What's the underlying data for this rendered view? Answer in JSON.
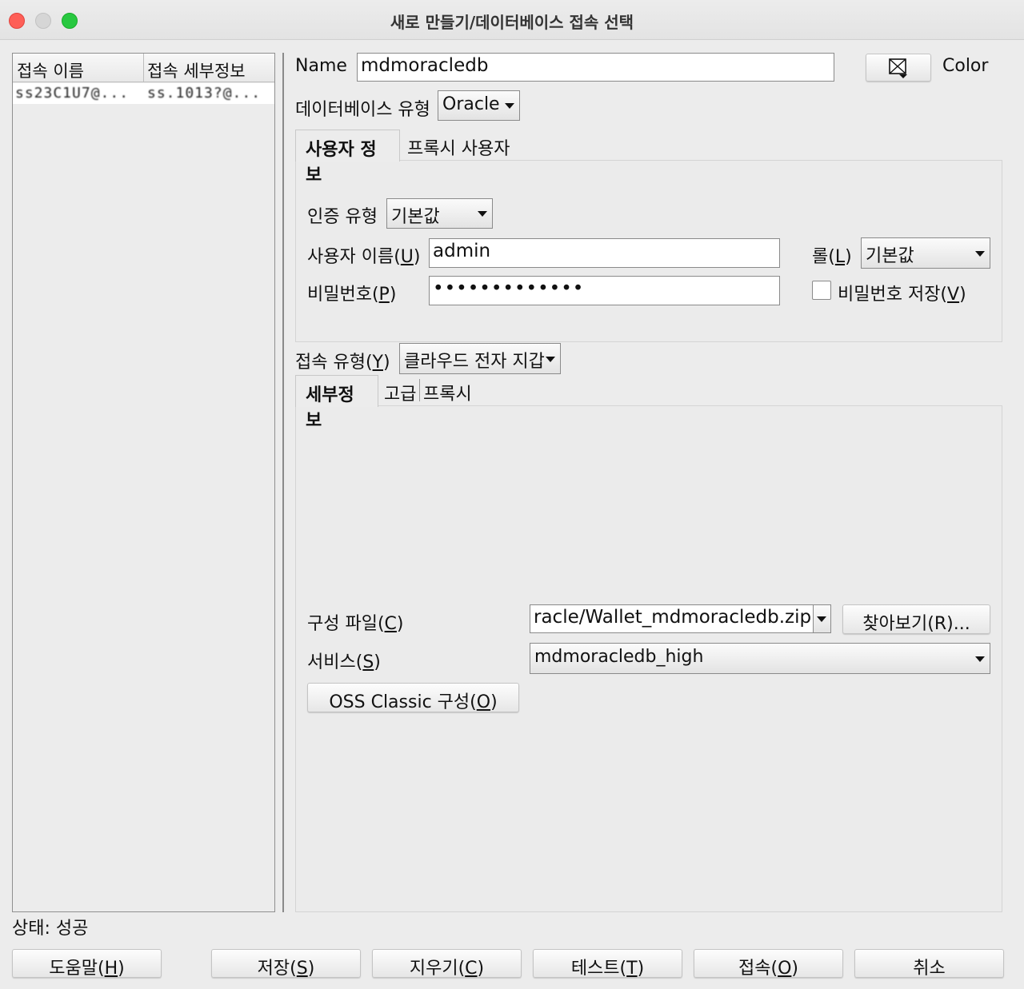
{
  "window": {
    "title": "새로 만들기/데이터베이스 접속 선택"
  },
  "connection_list": {
    "columns": [
      "접속 이름",
      "접속 세부정보"
    ],
    "rows": [
      {
        "name": "ss23C1U7@...",
        "details": "ss.1013?@..."
      }
    ]
  },
  "form": {
    "name_label": "Name",
    "name_value": "mdmoracledb",
    "color_label": "Color",
    "color_icon": "color-picker-icon",
    "db_type_label": "데이터베이스 유형",
    "db_type_value": "Oracle",
    "tabs_user": [
      "사용자 정보",
      "프록시 사용자"
    ],
    "auth_type_label": "인증 유형",
    "auth_type_value": "기본값",
    "username_label_pre": "사용자 이름(",
    "username_mnemonic": "U",
    "username_label_post": ")",
    "username_value": "admin",
    "role_label_pre": "롤(",
    "role_mnemonic": "L",
    "role_label_post": ")",
    "role_value": "기본값",
    "password_label_pre": "비밀번호(",
    "password_mnemonic": "P",
    "password_label_post": ")",
    "password_value": "•••••••••••••",
    "save_password_pre": "비밀번호 저장(",
    "save_password_mnemonic": "V",
    "save_password_post": ")",
    "save_password_checked": false,
    "conn_type_label_pre": "접속 유형(",
    "conn_type_mnemonic": "Y",
    "conn_type_label_post": ")",
    "conn_type_value": "클라우드 전자 지갑",
    "tabs_details": [
      "세부정보",
      "고급",
      "프록시"
    ],
    "config_file_label_pre": "구성 파일(",
    "config_file_mnemonic": "C",
    "config_file_label_post": ")",
    "config_file_value": "racle/Wallet_mdmoracledb.zip",
    "browse_label": "찾아보기(R)...",
    "service_label_pre": "서비스(",
    "service_mnemonic": "S",
    "service_label_post": ")",
    "service_value": "mdmoracledb_high",
    "oss_button_pre": "OSS Classic 구성(",
    "oss_button_mnemonic": "O",
    "oss_button_post": ")"
  },
  "status": {
    "text": "상태: 성공"
  },
  "footer": {
    "help_pre": "도움말(",
    "help_m": "H",
    "save_pre": "저장(",
    "save_m": "S",
    "clear_pre": "지우기(",
    "clear_m": "C",
    "test_pre": "테스트(",
    "test_m": "T",
    "connect_pre": "접속(",
    "connect_m": "O",
    "close_paren": ")",
    "cancel": "취소"
  }
}
